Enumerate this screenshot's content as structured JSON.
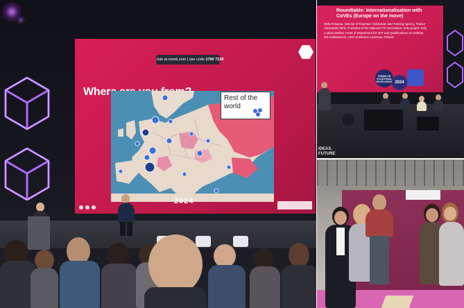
{
  "photo_main": {
    "join_banner_prefix": "Join at menti.com | use code ",
    "join_code": "1790 7228",
    "slide_question": "Where are you from?",
    "map_callout_line1": "Rest of the",
    "map_callout_line2": "world",
    "slide_year": "2024"
  },
  "photo_panel": {
    "title_line1": "Roundtable: Internationalisation with",
    "title_line2": "CoVEs (Europe on the move)",
    "speakers": [
      "Nelly Fesseau, Director of Erasmus+ Education and Training Agency, France",
      "Alessandro Mele, President of the National ITS Association, Ente project, Italy",
      "Loukas Zahilas, Head of Department for VET and Qualifications at Cedefop",
      "Ola Kukkasniemi, CEO of Western Uusimaa, Finland"
    ],
    "badge_text": "FORUM ON VOCATIONAL EXCELLENCE",
    "badge_year": "2024",
    "bottom_text_line1": "IDEAS.",
    "bottom_text_line2": "FUTURE"
  },
  "colors": {
    "slide_accent": "#d81f55",
    "map_sea": "#4b8fb4",
    "neon_purple": "#b06bff",
    "booth_wall": "#8d3057",
    "booth_floor": "#d966b3"
  }
}
